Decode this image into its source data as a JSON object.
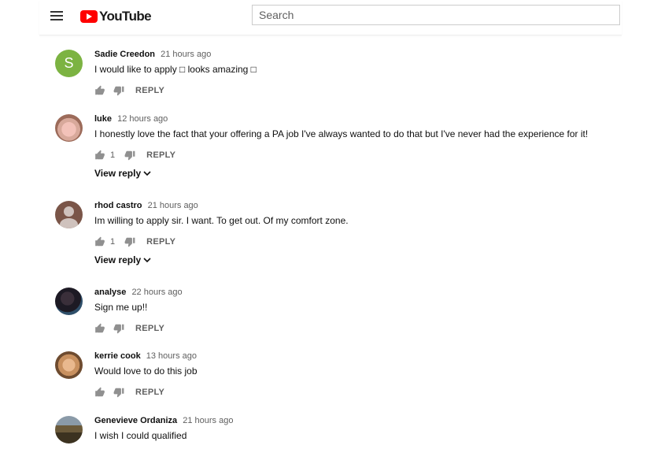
{
  "header": {
    "brand": "YouTube",
    "search_placeholder": "Search"
  },
  "comments": [
    {
      "author": "Sadie Creedon",
      "time": "21 hours ago",
      "text": "I would like to apply □ looks amazing □",
      "likes": "",
      "reply_label": "REPLY",
      "view_reply": "",
      "avatar": "S"
    },
    {
      "author": "luke",
      "time": "12 hours ago",
      "text": "I honestly love the fact that your offering a PA job I've always wanted to do that but I've never had the experience for it!",
      "likes": "1",
      "reply_label": "REPLY",
      "view_reply": "View reply"
    },
    {
      "author": "rhod castro",
      "time": "21 hours ago",
      "text": "Im willing to apply sir. I want. To get out. Of my comfort zone.",
      "likes": "1",
      "reply_label": "REPLY",
      "view_reply": "View reply"
    },
    {
      "author": "analyse",
      "time": "22 hours ago",
      "text": "Sign me up!!",
      "likes": "",
      "reply_label": "REPLY",
      "view_reply": ""
    },
    {
      "author": "kerrie cook",
      "time": "13 hours ago",
      "text": "Would love to do this job",
      "likes": "",
      "reply_label": "REPLY",
      "view_reply": ""
    },
    {
      "author": "Genevieve Ordaniza",
      "time": "21 hours ago",
      "text": "I wish I could qualified",
      "likes": "",
      "reply_label": "",
      "view_reply": ""
    }
  ],
  "icons": {
    "menu": "hamburger-menu-icon",
    "like": "thumbs-up-icon",
    "dislike": "thumbs-down-icon",
    "expand": "chevron-down-icon"
  },
  "colors": {
    "brand_red": "#ff0000",
    "text_primary": "#0f0f0f",
    "text_secondary": "#606060"
  }
}
